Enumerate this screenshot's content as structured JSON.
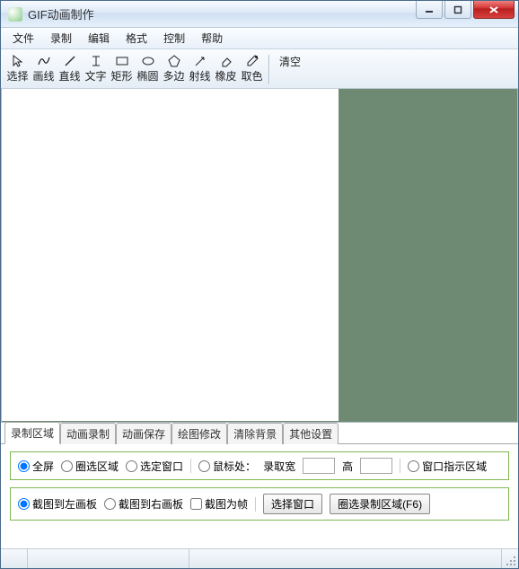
{
  "window": {
    "title": "GIF动画制作"
  },
  "menu": {
    "file": "文件",
    "record": "录制",
    "edit": "编辑",
    "format": "格式",
    "control": "控制",
    "help": "帮助"
  },
  "tools": {
    "select": "选择",
    "curve": "画线",
    "line": "直线",
    "text": "文字",
    "rect": "矩形",
    "ellipse": "椭圆",
    "polygon": "多边",
    "ray": "射线",
    "eraser": "橡皮",
    "picker": "取色",
    "clear": "清空"
  },
  "tabs": {
    "area": "录制区域",
    "record": "动画录制",
    "save": "动画保存",
    "draw": "绘图修改",
    "clearbg": "清除背景",
    "other": "其他设置"
  },
  "area_panel": {
    "fullscreen": "全屏",
    "boxselect": "圈选区域",
    "fixedwin": "选定窗口",
    "mouse_at": "鼠标处：",
    "rec_width": "录取宽",
    "height": "高",
    "win_indicator": "窗口指示区域",
    "cap_left": "截图到左画板",
    "cap_right": "截图到右画板",
    "cap_frame": "截图为帧",
    "choose_win": "选择窗口",
    "boxselect_btn": "圈选录制区域(F6)",
    "width_val": "",
    "height_val": ""
  }
}
